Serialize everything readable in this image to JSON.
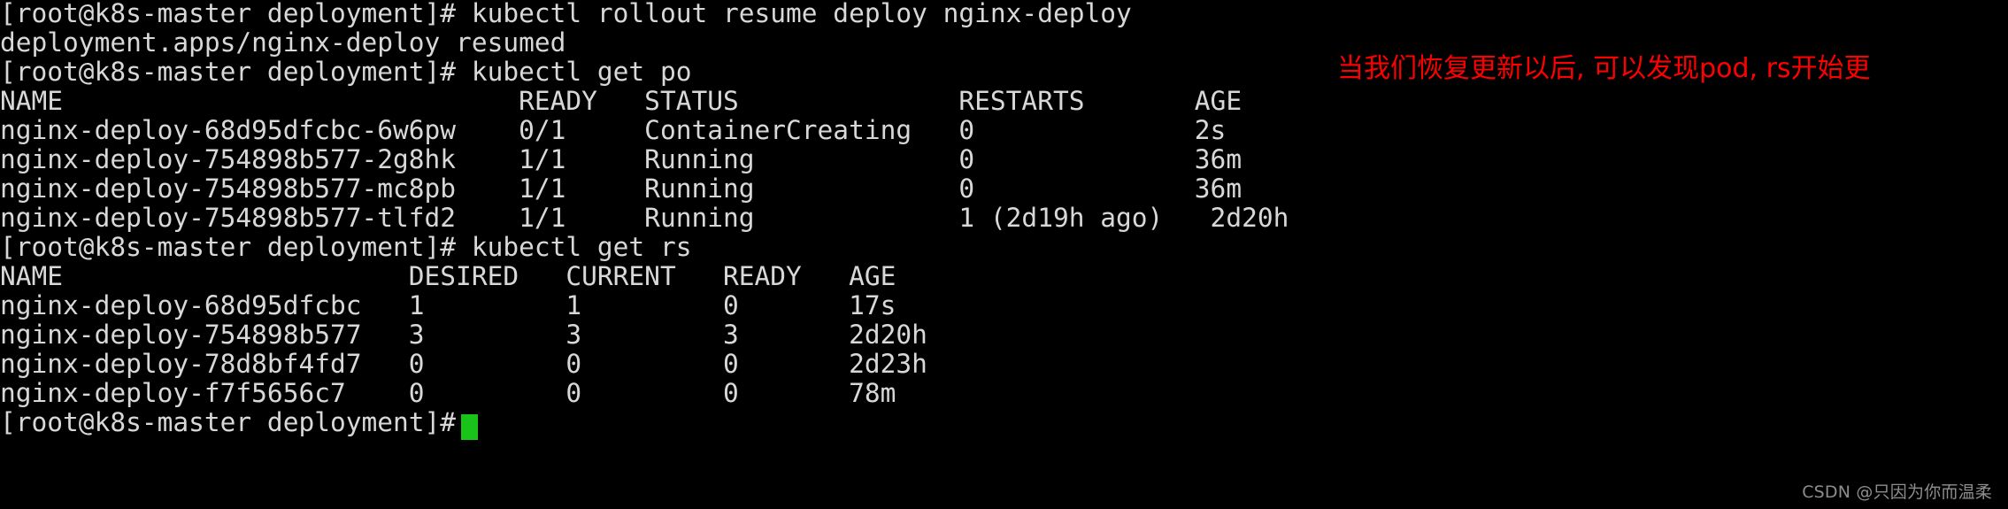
{
  "terminal": {
    "prompt": "[root@k8s-master deployment]# ",
    "background_color": "#000000",
    "foreground_color": "#d8d8d8",
    "cursor_color": "#19c319",
    "lines": [
      {
        "text": "[root@k8s-master deployment]# kubectl rollout resume deploy nginx-deploy",
        "type": "command"
      },
      {
        "text": "deployment.apps/nginx-deploy resumed",
        "type": "output"
      },
      {
        "text": "[root@k8s-master deployment]# kubectl get po",
        "type": "command"
      },
      {
        "text": "NAME                             READY   STATUS              RESTARTS       AGE",
        "type": "header"
      },
      {
        "text": "nginx-deploy-68d95dfcbc-6w6pw    0/1     ContainerCreating   0              2s",
        "type": "output"
      },
      {
        "text": "nginx-deploy-754898b577-2g8hk    1/1     Running             0              36m",
        "type": "output"
      },
      {
        "text": "nginx-deploy-754898b577-mc8pb    1/1     Running             0              36m",
        "type": "output"
      },
      {
        "text": "nginx-deploy-754898b577-tlfd2    1/1     Running             1 (2d19h ago)   2d20h",
        "type": "output"
      },
      {
        "text": "[root@k8s-master deployment]# kubectl get rs",
        "type": "command"
      },
      {
        "text": "NAME                      DESIRED   CURRENT   READY   AGE",
        "type": "header"
      },
      {
        "text": "nginx-deploy-68d95dfcbc   1         1         0       17s",
        "type": "output"
      },
      {
        "text": "nginx-deploy-754898b577   3         3         3       2d20h",
        "type": "output"
      },
      {
        "text": "nginx-deploy-78d8bf4fd7   0         0         0       2d23h",
        "type": "output"
      },
      {
        "text": "nginx-deploy-f7f5656c7    0         0         0       78m",
        "type": "output"
      },
      {
        "text": "[root@k8s-master deployment]#",
        "type": "command"
      }
    ],
    "commands": [
      "kubectl rollout resume deploy nginx-deploy",
      "kubectl get po",
      "kubectl get rs"
    ],
    "pod_table": {
      "headers": [
        "NAME",
        "READY",
        "STATUS",
        "RESTARTS",
        "AGE"
      ],
      "rows": [
        [
          "nginx-deploy-68d95dfcbc-6w6pw",
          "0/1",
          "ContainerCreating",
          "0",
          "2s"
        ],
        [
          "nginx-deploy-754898b577-2g8hk",
          "1/1",
          "Running",
          "0",
          "36m"
        ],
        [
          "nginx-deploy-754898b577-mc8pb",
          "1/1",
          "Running",
          "0",
          "36m"
        ],
        [
          "nginx-deploy-754898b577-tlfd2",
          "1/1",
          "Running",
          "1 (2d19h ago)",
          "2d20h"
        ]
      ]
    },
    "rs_table": {
      "headers": [
        "NAME",
        "DESIRED",
        "CURRENT",
        "READY",
        "AGE"
      ],
      "rows": [
        [
          "nginx-deploy-68d95dfcbc",
          "1",
          "1",
          "0",
          "17s"
        ],
        [
          "nginx-deploy-754898b577",
          "3",
          "3",
          "3",
          "2d20h"
        ],
        [
          "nginx-deploy-78d8bf4fd7",
          "0",
          "0",
          "0",
          "2d23h"
        ],
        [
          "nginx-deploy-f7f5656c7",
          "0",
          "0",
          "0",
          "78m"
        ]
      ]
    }
  },
  "annotation": {
    "text": "当我们恢复更新以后, 可以发现pod, rs开始更",
    "color": "#ff0000"
  },
  "watermark": {
    "text": "CSDN @只因为你而温柔",
    "color": "#8d8d8d"
  }
}
